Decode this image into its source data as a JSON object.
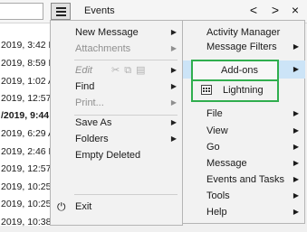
{
  "toolbar": {
    "tab_title": "Events",
    "nav_prev": "<",
    "nav_next": ">",
    "close": "×"
  },
  "message_list": [
    {
      "date": "2019, 3:42 PM",
      "bold": false
    },
    {
      "date": "2019, 8:59 PM",
      "bold": false
    },
    {
      "date": "2019, 1:02 AM",
      "bold": false
    },
    {
      "date": "2019, 12:57 AM",
      "bold": false
    },
    {
      "date": "/2019, 9:44 AM",
      "bold": true
    },
    {
      "date": "2019, 6:29 AM",
      "bold": false
    },
    {
      "date": "2019, 2:46 PM",
      "bold": false
    },
    {
      "date": "2019, 12:57 AM",
      "bold": false
    },
    {
      "date": "2019, 10:25 AM",
      "bold": false
    },
    {
      "date": "2019, 10:25 AM",
      "bold": false
    },
    {
      "date": "2019, 10:38 AM",
      "bold": false
    }
  ],
  "main_menu": {
    "new_message": "New Message",
    "attachments": "Attachments",
    "edit": "Edit",
    "edit_icons": "✂⧉▤",
    "find": "Find",
    "print": "Print...",
    "save_as": "Save As",
    "folders": "Folders",
    "empty_deleted": "Empty Deleted",
    "exit": "Exit",
    "exit_icon": "⏻"
  },
  "submenu": {
    "activity_manager": "Activity Manager",
    "message_filters": "Message Filters",
    "add_ons": "Add-ons",
    "lightning": "Lightning",
    "file": "File",
    "view": "View",
    "go": "Go",
    "message": "Message",
    "events_and_tasks": "Events and Tasks",
    "tools": "Tools",
    "help": "Help"
  },
  "colors": {
    "highlight_border": "#2fae4e",
    "hover_row": "#cce4f7"
  }
}
